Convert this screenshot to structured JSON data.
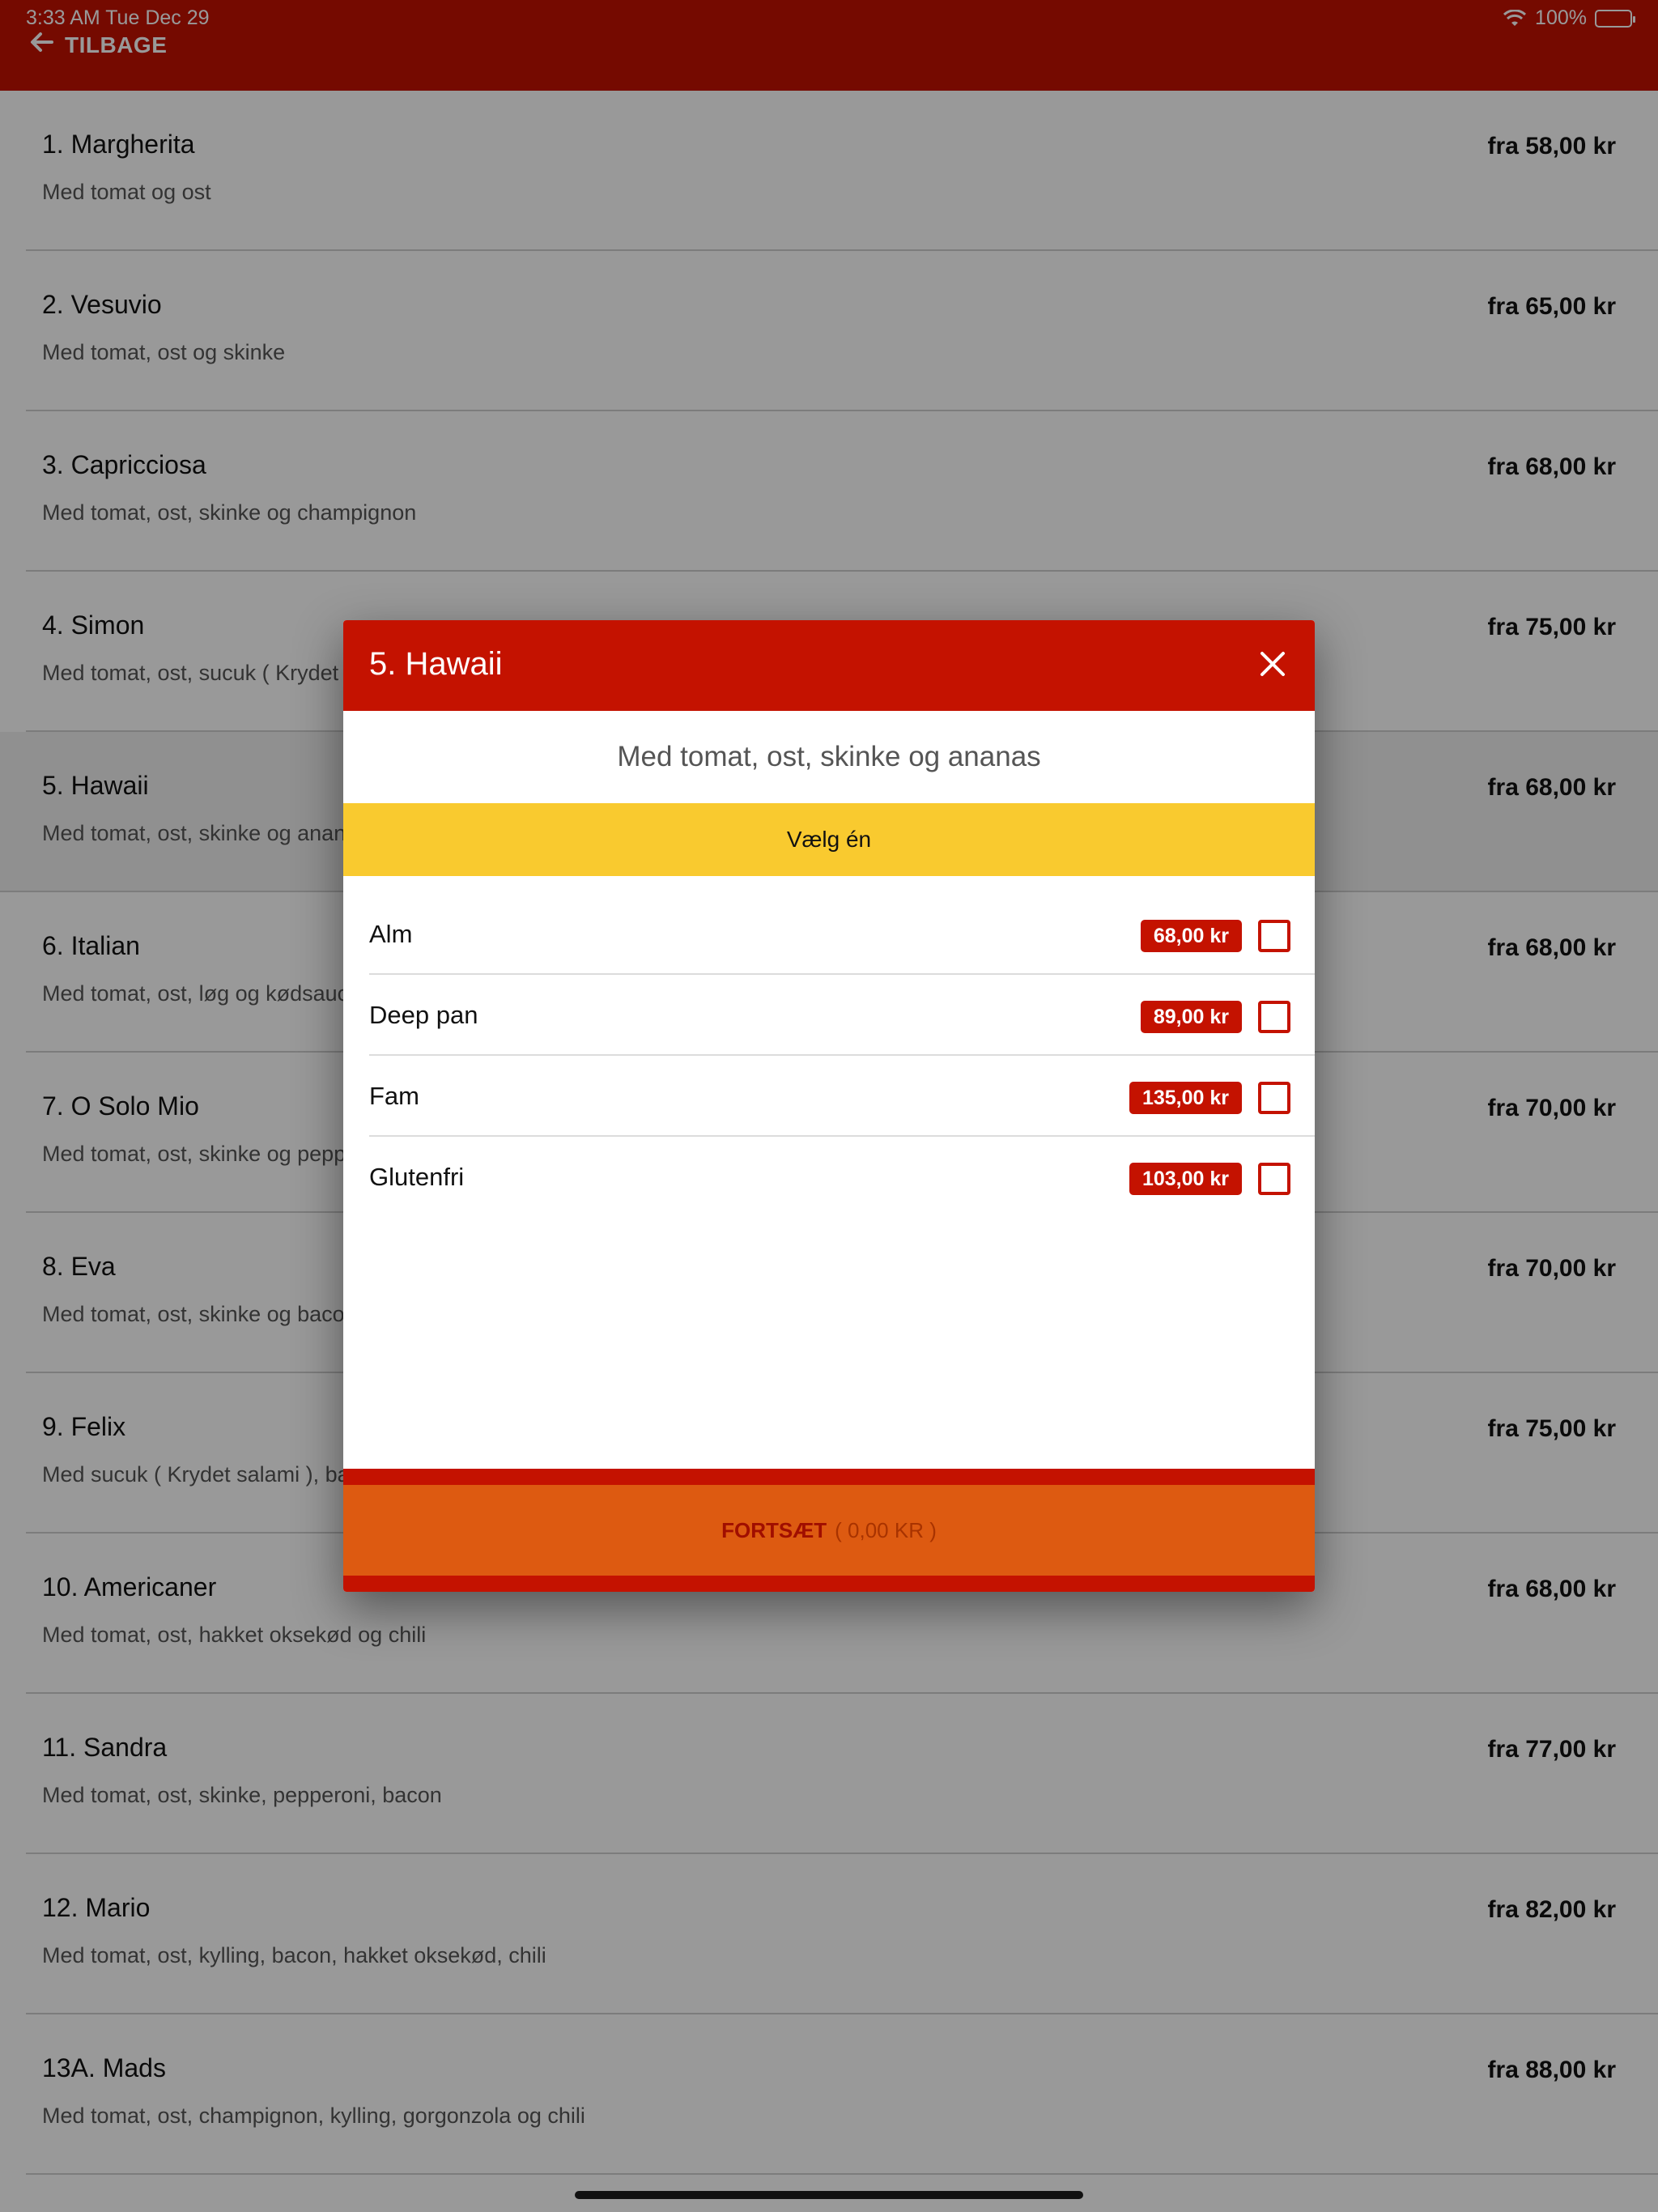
{
  "status_bar": {
    "time": "3:33 AM   Tue Dec 29",
    "battery": "100%"
  },
  "header": {
    "back_label": "TILBAGE"
  },
  "menu_items": [
    {
      "name": "1. Margherita",
      "desc": "Med tomat og ost",
      "price": "fra 58,00 kr"
    },
    {
      "name": "2. Vesuvio",
      "desc": "Med tomat, ost og skinke",
      "price": "fra 65,00 kr"
    },
    {
      "name": "3. Capricciosa",
      "desc": "Med tomat, ost, skinke og champignon",
      "price": "fra 68,00 kr"
    },
    {
      "name": "4. Simon",
      "desc": "Med tomat, ost, sucuk ( Krydet salami )",
      "price": "fra 75,00 kr"
    },
    {
      "name": "5. Hawaii",
      "desc": "Med tomat, ost, skinke og ananas",
      "price": "fra 68,00 kr"
    },
    {
      "name": "6. Italian",
      "desc": "Med tomat, ost, løg og kødsauce",
      "price": "fra 68,00 kr"
    },
    {
      "name": "7. O Solo Mio",
      "desc": "Med tomat, ost, skinke og pepperoni",
      "price": "fra 70,00 kr"
    },
    {
      "name": "8. Eva",
      "desc": "Med tomat, ost, skinke og bacon",
      "price": "fra 70,00 kr"
    },
    {
      "name": "9. Felix",
      "desc": "Med sucuk ( Krydet salami ), bacon",
      "price": "fra 75,00 kr"
    },
    {
      "name": "10. Americaner",
      "desc": "Med tomat, ost, hakket oksekød og chili",
      "price": "fra 68,00 kr"
    },
    {
      "name": "11. Sandra",
      "desc": "Med tomat, ost, skinke, pepperoni, bacon",
      "price": "fra 77,00 kr"
    },
    {
      "name": "12. Mario",
      "desc": "Med tomat, ost, kylling, bacon, hakket oksekød, chili",
      "price": "fra 82,00 kr"
    },
    {
      "name": "13A. Mads",
      "desc": "Med tomat, ost, champignon, kylling, gorgonzola og chili",
      "price": "fra 88,00 kr"
    }
  ],
  "modal": {
    "title": "5. Hawaii",
    "description": "Med tomat, ost, skinke og ananas",
    "choose_label": "Vælg én",
    "options": [
      {
        "name": "Alm",
        "price": "68,00 kr",
        "checked": false
      },
      {
        "name": "Deep pan",
        "price": "89,00 kr",
        "checked": false
      },
      {
        "name": "Fam",
        "price": "135,00 kr",
        "checked": false
      },
      {
        "name": "Glutenfri",
        "price": "103,00 kr",
        "checked": false
      }
    ],
    "continue_label": "FORTSÆT",
    "continue_total": "( 0,00 KR )"
  },
  "colors": {
    "brand_red": "#c41200",
    "yellow": "#f9ca2f",
    "orange": "#dd5a11"
  },
  "icons": {
    "back": "arrow-left-icon",
    "close": "close-icon",
    "wifi": "wifi-icon",
    "battery": "battery-icon",
    "checkbox": "checkbox-icon"
  }
}
